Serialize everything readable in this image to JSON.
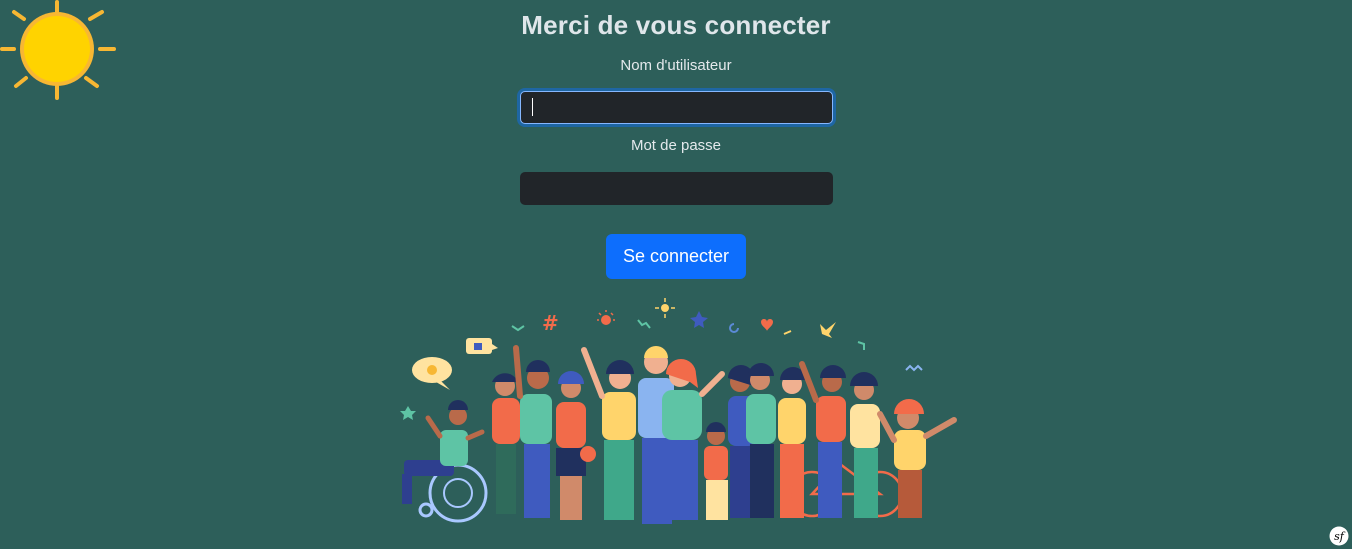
{
  "login": {
    "title": "Merci de vous connecter",
    "username_label": "Nom d'utilisateur",
    "username_value": "",
    "password_label": "Mot de passe",
    "password_value": "",
    "submit_label": "Se connecter"
  },
  "decorations": {
    "sun_icon": "sun-icon",
    "illustration": "people-celebrating-illustration",
    "footer_icon": "symfony-logo-icon"
  },
  "colors": {
    "background": "#2d5f5a",
    "input_background": "#212529",
    "primary_button": "#0d6efd",
    "sun": "#ffd300"
  }
}
